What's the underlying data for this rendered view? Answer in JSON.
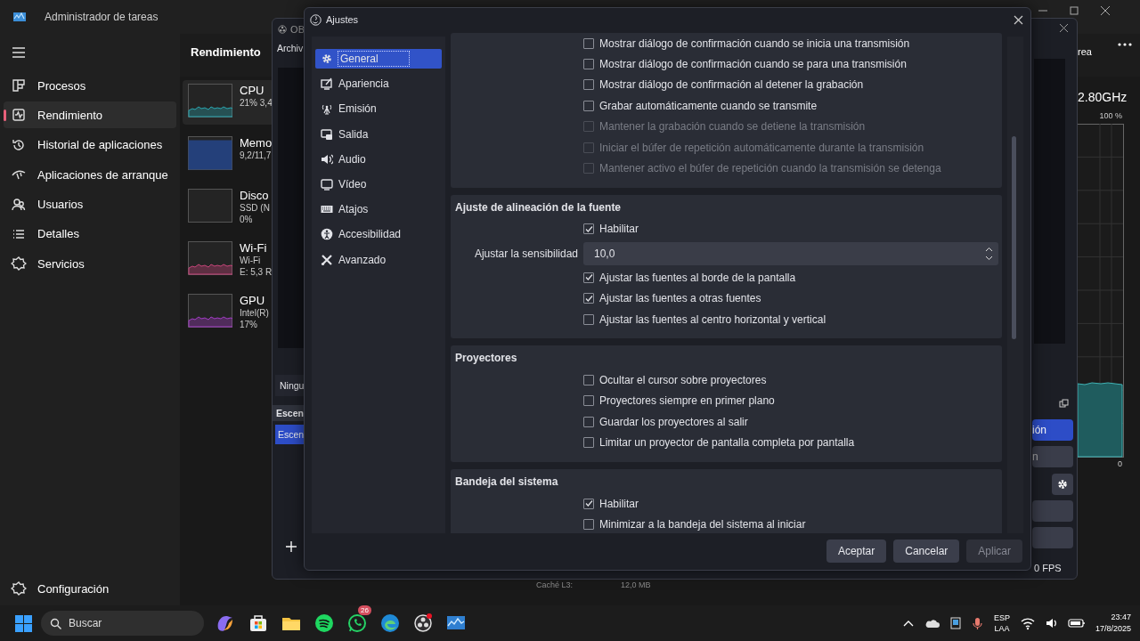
{
  "task_manager": {
    "title": "Administrador de tareas",
    "nav": [
      {
        "label": "Procesos",
        "selected": false
      },
      {
        "label": "Rendimiento",
        "selected": true
      },
      {
        "label": "Historial de aplicaciones",
        "selected": false
      },
      {
        "label": "Aplicaciones de arranque",
        "selected": false
      },
      {
        "label": "Usuarios",
        "selected": false
      },
      {
        "label": "Detalles",
        "selected": false
      },
      {
        "label": "Servicios",
        "selected": false
      }
    ],
    "settings_label": "Configuración",
    "page_title": "Rendimiento",
    "perf_items": [
      {
        "name": "CPU",
        "details": [
          "21% 3,4"
        ],
        "color": "#2aa6b0",
        "selected": true
      },
      {
        "name": "Memo",
        "details": [
          "9,2/11,7"
        ],
        "color": "#24407a",
        "selected": false
      },
      {
        "name": "Disco",
        "details": [
          "SSD (N",
          "0%"
        ],
        "selected": false
      },
      {
        "name": "Wi-Fi",
        "details": [
          "Wi-Fi",
          "E: 5,3 R"
        ],
        "color": "#c8457a",
        "selected": false
      },
      {
        "name": "GPU",
        "details": [
          "Intel(R)",
          "17%"
        ],
        "color": "#a23cc4",
        "selected": false
      }
    ],
    "action": "rea",
    "speed": "2.80GHz",
    "graph_max": "100 %",
    "graph_min": "0",
    "footer": [
      "Caché L3:",
      "12,0 MB"
    ]
  },
  "obs": {
    "title": "OB",
    "menu": "Archiv",
    "mixer": "Ningu",
    "scenes_header": "Escen",
    "scene": "Escen",
    "controls": [
      "ión",
      "n"
    ],
    "status": "0 FPS"
  },
  "settings": {
    "title": "Ajustes",
    "categories": [
      {
        "label": "General",
        "selected": true
      },
      {
        "label": "Apariencia",
        "selected": false
      },
      {
        "label": "Emisión",
        "selected": false
      },
      {
        "label": "Salida",
        "selected": false
      },
      {
        "label": "Audio",
        "selected": false
      },
      {
        "label": "Vídeo",
        "selected": false
      },
      {
        "label": "Atajos",
        "selected": false
      },
      {
        "label": "Accesibilidad",
        "selected": false
      },
      {
        "label": "Avanzado",
        "selected": false
      }
    ],
    "groups": [
      {
        "items": [
          {
            "kind": "checkbox",
            "label": "Mostrar diálogo de confirmación cuando se inicia una transmisión",
            "checked": false,
            "disabled": false
          },
          {
            "kind": "checkbox",
            "label": "Mostrar diálogo de confirmación cuando se para una transmisión",
            "checked": false,
            "disabled": false
          },
          {
            "kind": "checkbox",
            "label": "Mostrar diálogo de confirmación al detener la grabación",
            "checked": false,
            "disabled": false
          },
          {
            "kind": "checkbox",
            "label": "Grabar automáticamente cuando se transmite",
            "checked": false,
            "disabled": false
          },
          {
            "kind": "checkbox",
            "label": "Mantener la grabación cuando se detiene la transmisión",
            "checked": false,
            "disabled": true
          },
          {
            "kind": "checkbox",
            "label": "Iniciar el búfer de repetición automáticamente durante la transmisión",
            "checked": false,
            "disabled": true
          },
          {
            "kind": "checkbox",
            "label": "Mantener activo el búfer de repetición cuando la transmisión se detenga",
            "checked": false,
            "disabled": true
          }
        ]
      },
      {
        "title": "Ajuste de alineación de la fuente",
        "items": [
          {
            "kind": "checkbox",
            "label": "Habilitar",
            "checked": true,
            "disabled": false
          },
          {
            "kind": "spin",
            "label": "Ajustar la sensibilidad",
            "value": "10,0"
          },
          {
            "kind": "checkbox",
            "label": "Ajustar las fuentes al borde de la pantalla",
            "checked": true,
            "disabled": false
          },
          {
            "kind": "checkbox",
            "label": "Ajustar las fuentes a otras fuentes",
            "checked": true,
            "disabled": false
          },
          {
            "kind": "checkbox",
            "label": "Ajustar las fuentes al centro horizontal y vertical",
            "checked": false,
            "disabled": false
          }
        ]
      },
      {
        "title": "Proyectores",
        "items": [
          {
            "kind": "checkbox",
            "label": "Ocultar el cursor sobre proyectores",
            "checked": false,
            "disabled": false
          },
          {
            "kind": "checkbox",
            "label": "Proyectores siempre en primer plano",
            "checked": false,
            "disabled": false
          },
          {
            "kind": "checkbox",
            "label": "Guardar los proyectores al salir",
            "checked": false,
            "disabled": false
          },
          {
            "kind": "checkbox",
            "label": "Limitar un proyector de pantalla completa por pantalla",
            "checked": false,
            "disabled": false
          }
        ]
      },
      {
        "title": "Bandeja del sistema",
        "items": [
          {
            "kind": "checkbox",
            "label": "Habilitar",
            "checked": true,
            "disabled": false
          },
          {
            "kind": "checkbox",
            "label": "Minimizar a la bandeja del sistema al iniciar",
            "checked": false,
            "disabled": false
          }
        ]
      }
    ],
    "buttons": [
      {
        "label": "Aceptar",
        "disabled": false
      },
      {
        "label": "Cancelar",
        "disabled": false
      },
      {
        "label": "Aplicar",
        "disabled": true
      }
    ]
  },
  "taskbar": {
    "search_placeholder": "Buscar",
    "badge": "26",
    "language": [
      "ESP",
      "LAA"
    ],
    "time": "23:47",
    "date": "17/8/2025"
  }
}
